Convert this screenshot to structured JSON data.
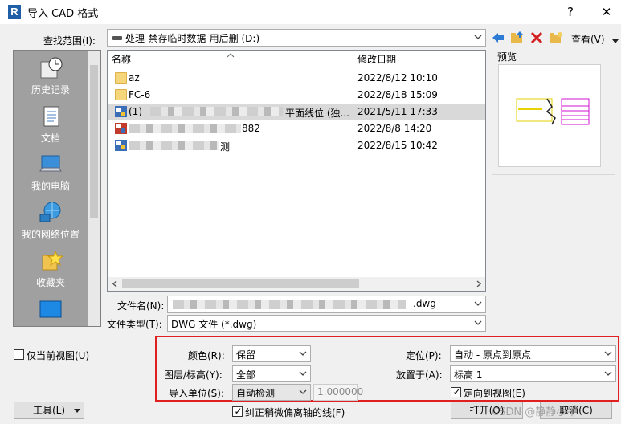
{
  "window": {
    "title": "导入 CAD 格式",
    "app_icon": "R",
    "help": "?",
    "close": "✕"
  },
  "top": {
    "look_in_label": "查找范围(I):",
    "look_in_value": "处理-禁存临时数据-用后删 (D:)",
    "view_label": "查看(V)"
  },
  "places": [
    {
      "label": "历史记录",
      "icon": "history-icon"
    },
    {
      "label": "文档",
      "icon": "documents-icon"
    },
    {
      "label": "我的电脑",
      "icon": "computer-icon"
    },
    {
      "label": "我的网络位置",
      "icon": "network-icon"
    },
    {
      "label": "收藏夹",
      "icon": "favorites-icon"
    }
  ],
  "files": {
    "col_name": "名称",
    "col_date": "修改日期",
    "rows": [
      {
        "name": "az",
        "date": "2022/8/12 10:10",
        "type": "folder"
      },
      {
        "name": "FC-6",
        "date": "2022/8/18 15:09",
        "type": "folder"
      },
      {
        "name_prefix": "(1)",
        "name_suffix": "平面线位 (独...",
        "date": "2021/5/11 17:33",
        "type": "dwg",
        "selected": true
      },
      {
        "name_suffix": "882",
        "date": "2022/8/8 14:20",
        "type": "dwg"
      },
      {
        "name_suffix": "测",
        "date": "2022/8/15 10:42",
        "type": "dwg"
      }
    ]
  },
  "preview": {
    "label": "预览"
  },
  "filename": {
    "label": "文件名(N):",
    "ext": ".dwg"
  },
  "filetype": {
    "label": "文件类型(T):",
    "value": "DWG 文件 (*.dwg)"
  },
  "current_view_only": {
    "label": "仅当前视图(U)",
    "checked": false
  },
  "options": {
    "color_label": "颜色(R):",
    "color_value": "保留",
    "layers_label": "图层/标高(Y):",
    "layers_value": "全部",
    "units_label": "导入单位(S):",
    "units_value": "自动检测",
    "units_factor": "1.000000",
    "position_label": "定位(P):",
    "position_value": "自动 - 原点到原点",
    "place_at_label": "放置于(A):",
    "place_at_value": "标高 1",
    "orient_label": "定向到视图(E)",
    "orient_checked": true
  },
  "correct_lines": {
    "label": "纠正稍微偏离轴的线(F)",
    "checked": true
  },
  "buttons": {
    "tools": "工具(L)",
    "open": "打开(O)",
    "cancel": "取消(C)"
  },
  "watermark": "CSDN @静静小牛"
}
